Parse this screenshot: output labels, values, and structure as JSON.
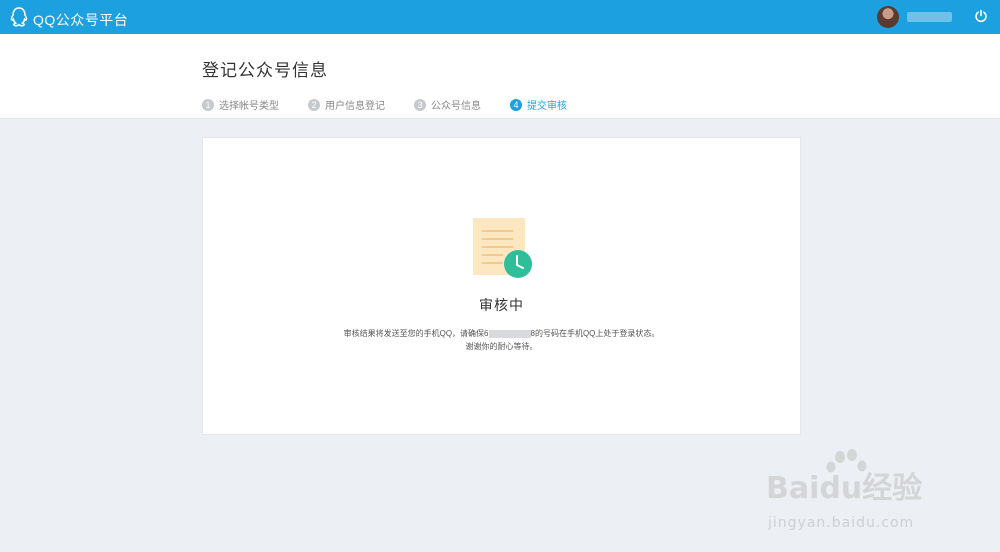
{
  "topbar": {
    "brand": "QQ公众号平台",
    "logo_icon": "qq-penguin-icon",
    "avatar_icon": "user-avatar",
    "power_icon": "power-icon"
  },
  "header": {
    "title": "登记公众号信息",
    "steps": [
      {
        "num": "1",
        "label": "选择帐号类型"
      },
      {
        "num": "2",
        "label": "用户信息登记"
      },
      {
        "num": "3",
        "label": "公众号信息"
      },
      {
        "num": "4",
        "label": "提交审核"
      }
    ],
    "active_step": 4
  },
  "card": {
    "illustration_icon": "document-clock-icon",
    "status_title": "审核中",
    "desc_line1_before": "审核结果将发送至您的手机QQ，请确保6",
    "desc_line1_after": "8的号码在手机QQ上处于登录状态。",
    "desc_line2": "谢谢你的耐心等待。"
  },
  "watermark": {
    "text_main": "Baidu经验",
    "text_sub": "jingyan.baidu.com"
  },
  "colors": {
    "accent": "#1ca0df",
    "clock_green": "#2ebf9a",
    "doc_paper": "#fde7c0"
  }
}
